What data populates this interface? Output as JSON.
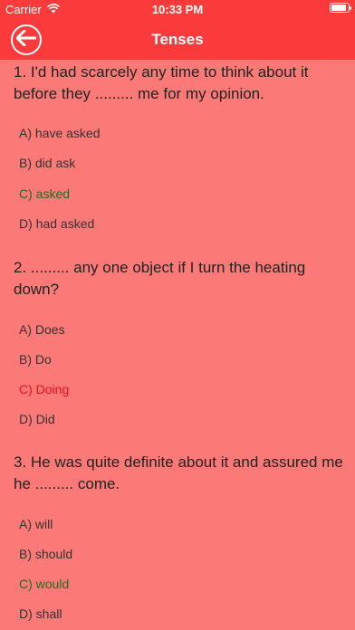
{
  "status_bar": {
    "carrier": "Carrier",
    "time": "10:33 PM"
  },
  "nav": {
    "title": "Tenses",
    "back_icon": "back-arrow-icon"
  },
  "colors": {
    "header": "#fb3b3b",
    "background": "#fb7a78",
    "correct": "#1f6e1f",
    "wrong": "#e5141b"
  },
  "questions": [
    {
      "text": "1. I'd had scarcely any time to think about it before they ......... me for my opinion.",
      "options": [
        "A) have asked",
        "B) did ask",
        "C) asked",
        "D) had asked"
      ],
      "states": [
        "normal",
        "normal",
        "correct",
        "normal"
      ]
    },
    {
      "text": "2. ......... any one object if I turn the heating down?",
      "options": [
        "A) Does",
        "B) Do",
        "C) Doing",
        "D) Did"
      ],
      "states": [
        "normal",
        "normal",
        "wrong",
        "normal"
      ]
    },
    {
      "text": "3. He was quite definite about it and assured me he ......... come.",
      "options": [
        "A) will",
        "B) should",
        "C) would",
        "D) shall"
      ],
      "states": [
        "normal",
        "normal",
        "correct",
        "normal"
      ]
    }
  ]
}
